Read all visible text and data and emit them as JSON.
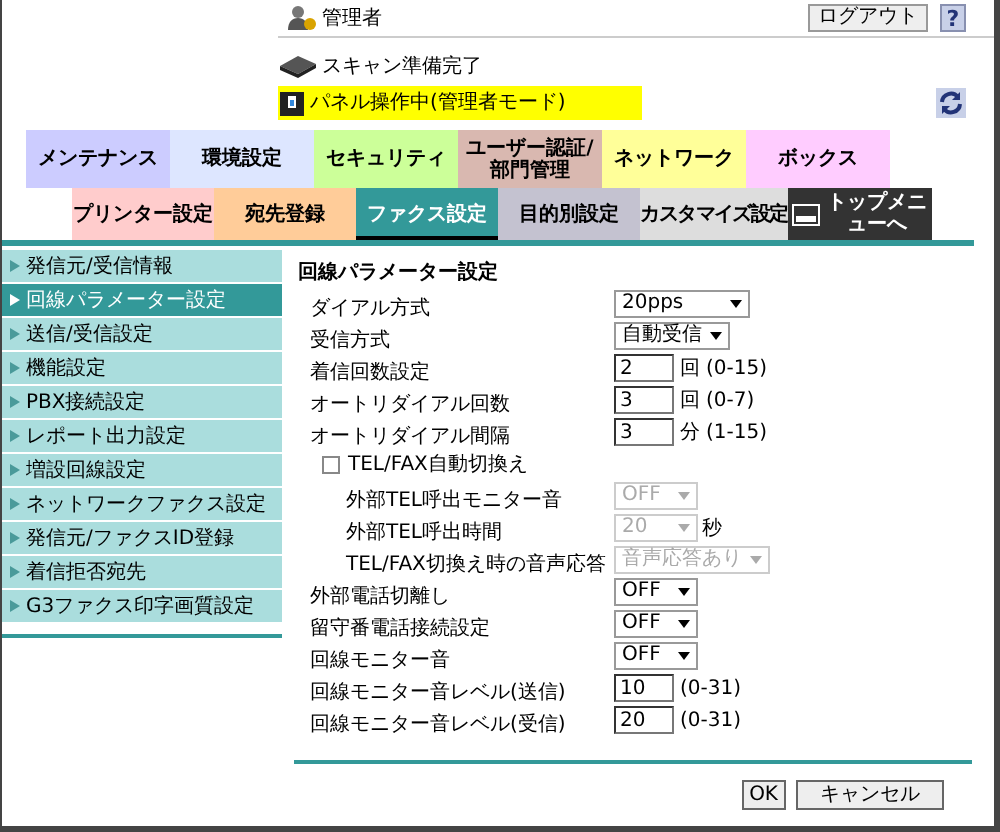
{
  "header": {
    "user": "管理者",
    "logout_button": "ログアウト",
    "help_button": "?",
    "scan_status": "スキャン準備完了",
    "panel_status": "パネル操作中(管理者モード)"
  },
  "main_tabs": [
    {
      "label": "メンテナンス",
      "color": "#ccccff",
      "selected": false
    },
    {
      "label": "環境設定",
      "color": "#dde6ff",
      "selected": false
    },
    {
      "label": "セキュリティ",
      "color": "#ccff99",
      "selected": false
    },
    {
      "label": "ユーザー認証/部門管理",
      "color": "#d9b8b0",
      "selected": false
    },
    {
      "label": "ネットワーク",
      "color": "#ffff99",
      "selected": false
    },
    {
      "label": "ボックス",
      "color": "#ffccff",
      "selected": false
    }
  ],
  "sub_tabs": [
    {
      "label": "プリンター設定",
      "color": "#ffcccc",
      "selected": false,
      "kind": "tab"
    },
    {
      "label": "宛先登録",
      "color": "#ffcc99",
      "selected": false,
      "kind": "tab"
    },
    {
      "label": "ファクス設定",
      "color": "#339999",
      "selected": true,
      "kind": "tab"
    },
    {
      "label": "目的別設定",
      "color": "#c4c2d0",
      "selected": false,
      "kind": "tab"
    },
    {
      "label": "カスタマイズ設定",
      "color": "#dddddd",
      "selected": false,
      "kind": "tab"
    },
    {
      "label": "トップメニューへ",
      "color": "#333333",
      "selected": false,
      "kind": "home"
    }
  ],
  "sidebar": {
    "items": [
      {
        "label": "発信元/受信情報",
        "selected": false
      },
      {
        "label": "回線パラメーター設定",
        "selected": true
      },
      {
        "label": "送信/受信設定",
        "selected": false
      },
      {
        "label": "機能設定",
        "selected": false
      },
      {
        "label": "PBX接続設定",
        "selected": false
      },
      {
        "label": "レポート出力設定",
        "selected": false
      },
      {
        "label": "増設回線設定",
        "selected": false
      },
      {
        "label": "ネットワークファクス設定",
        "selected": false
      },
      {
        "label": "発信元/ファクスID登録",
        "selected": false
      },
      {
        "label": "着信拒否宛先",
        "selected": false
      },
      {
        "label": "G3ファクス印字画質設定",
        "selected": false
      }
    ]
  },
  "form": {
    "title": "回線パラメーター設定",
    "rows": [
      {
        "kind": "select",
        "label": "ダイアル方式",
        "value": "20pps",
        "disabled": false
      },
      {
        "kind": "select",
        "label": "受信方式",
        "value": "自動受信",
        "disabled": false
      },
      {
        "kind": "input",
        "label": "着信回数設定",
        "value": "2",
        "unit": "回",
        "range": "(0-15)"
      },
      {
        "kind": "input",
        "label": "オートリダイアル回数",
        "value": "3",
        "unit": "回",
        "range": "(0-7)"
      },
      {
        "kind": "input",
        "label": "オートリダイアル間隔",
        "value": "3",
        "unit": "分",
        "range": "(1-15)"
      },
      {
        "kind": "checkbox",
        "label": "TEL/FAX自動切換え",
        "checked": false,
        "children": [
          {
            "kind": "select",
            "label": "外部TEL呼出モニター音",
            "value": "OFF",
            "disabled": true
          },
          {
            "kind": "select",
            "label": "外部TEL呼出時間",
            "value": "20",
            "unit": "秒",
            "disabled": true
          },
          {
            "kind": "select",
            "label": "TEL/FAX切換え時の音声応答",
            "value": "音声応答あり",
            "disabled": true
          }
        ]
      },
      {
        "kind": "select",
        "label": "外部電話切離し",
        "value": "OFF",
        "disabled": false
      },
      {
        "kind": "select",
        "label": "留守番電話接続設定",
        "value": "OFF",
        "disabled": false
      },
      {
        "kind": "select",
        "label": "回線モニター音",
        "value": "OFF",
        "disabled": false
      },
      {
        "kind": "input",
        "label": "回線モニター音レベル(送信)",
        "value": "10",
        "range": "(0-31)"
      },
      {
        "kind": "input",
        "label": "回線モニター音レベル(受信)",
        "value": "20",
        "range": "(0-31)"
      }
    ]
  },
  "buttons": [
    {
      "label": "OK"
    },
    {
      "label": "キャンセル"
    }
  ]
}
